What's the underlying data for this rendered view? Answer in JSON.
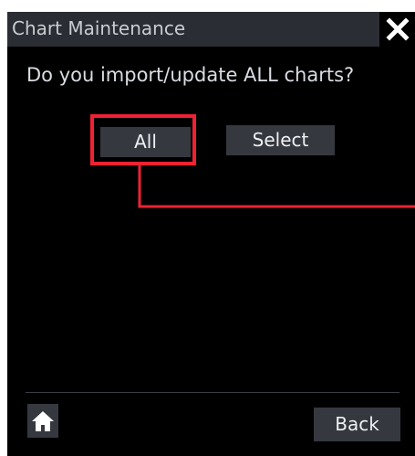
{
  "dialog": {
    "title": "Chart Maintenance",
    "close_icon": "close-icon",
    "question": "Do you import/update ALL charts?"
  },
  "buttons": {
    "all_label": "All",
    "select_label": "Select",
    "back_label": "Back",
    "home_icon": "home-icon"
  },
  "colors": {
    "background": "#000000",
    "titlebar": "#2a2d33",
    "button": "#35383f",
    "highlight": "#ee2233"
  }
}
